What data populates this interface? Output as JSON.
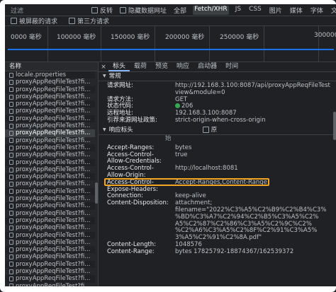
{
  "filter_bar": {
    "filter_label": "过滤",
    "invert_label": "反转",
    "hide_data_urls_label": "隐藏数据网址",
    "types": [
      "全部",
      "Fetch/XHR",
      "JS",
      "CSS",
      "图片",
      "媒体",
      "字体",
      "文档",
      "WS",
      "W"
    ]
  },
  "blocked_bar": {
    "blocked_requests_label": "被屏蔽的请求",
    "third_party_label": "第三方请求"
  },
  "timeline": {
    "ticks": [
      "0000 毫秒",
      "100000 毫秒",
      "150000 毫秒",
      "200000 毫秒",
      "250000 毫秒",
      "300000"
    ]
  },
  "requests": {
    "header": "名称",
    "items": [
      "locale.properties",
      "proxyAppReqFileTest?fi...",
      "proxyAppReqFileTest?fi...",
      "proxyAppReqFileTest?fi...",
      "proxyAppReqFileTest?fi...",
      "proxyAppReqFileTest?fi...",
      "proxyAppReqFileTest?fi...",
      "proxyAppReqFileTest?fi...",
      "proxyAppReqFileTest?fi...",
      "proxyAppReqFileTest?fi...",
      "proxyAppReqFileTest?fi...",
      "proxyAppReqFileTest?fi...",
      "proxyAppReqFileTest?fi...",
      "proxyAppReqFileTest?fi...",
      "proxyAppReqFileTest?fi...",
      "proxyAppReqFileTest?fi...",
      "proxyAppReqFileTest?fi...",
      "proxyAppReqFileTest?fi...",
      "proxyAppReqFileTest?fi...",
      "proxyAppReqFileTest?fi...",
      "proxyAppReqFileTest?fi...",
      "proxyAppReqFileTest?fi...",
      "proxyAppReqFileTest?fi...",
      "proxyAppReqFileTest?fi...",
      "proxyAppReqFileTest?fi...",
      "proxyAppReqFileTest?fi...",
      "proxyAppReqFileTest?fi...",
      "proxyAppReqFileTest?fi...",
      "proxyAppReqFileTest?fi...",
      "proxyAppReqFileTest?fi..."
    ]
  },
  "detail_tabs": {
    "close": "×",
    "items": [
      "标头",
      "载荷",
      "预览",
      "响应",
      "启动器",
      "时间"
    ]
  },
  "general": {
    "title": "常规",
    "request_url_label": "请求网址:",
    "request_url_value_1": "http://192.168.3.100:8087/api/proxyAppReqFileTest",
    "request_url_value_2": "view&module=0",
    "method_label": "请求方法:",
    "method_value": "GET",
    "status_label": "状态代码:",
    "status_value": "206",
    "remote_label": "远程地址:",
    "remote_value": "192.168.3.100:8087",
    "referrer_label": "引荐来源网址政策:",
    "referrer_value": "strict-origin-when-cross-origin"
  },
  "response_headers": {
    "title": "响应标头",
    "raw_label": "原",
    "sub_hint": "始",
    "h1_k": "Accept-Ranges:",
    "h1_v": "bytes",
    "h2_k1": "Access-Control-",
    "h2_k2": "Allow-Credentials:",
    "h2_v": "true",
    "h3_k1": "Access-Control-",
    "h3_k2": "Allow-Origin:",
    "h3_v": "http://localhost:8081",
    "h4_k1": "Access-Control-",
    "h4_k2": "Expose-Headers:",
    "h4_v": "Accept-Ranges,Content-Range",
    "h5_k": "Connection:",
    "h5_v": "keep-alive",
    "h6_k": "Content-Disposition:",
    "h6_v1": "attachment;",
    "h6_v2": "filename=\"2022%C3%A5%C2%B9%C2%B4%C3%",
    "h6_v3": "%BD%C3%A7%C2%94%C2%B5%C3%A5%C2%",
    "h6_v4": "A5%C2%87%C2%86%C3%A5%C2%9C%C2%",
    "h6_v5": "%C2%A6%C3%A5%C2%8F%C2%91%C3%A5%",
    "h6_v6": "3%A5%C2%91%C2%8A.pdf\"",
    "h7_k": "Content-Length:",
    "h7_v": "1048576",
    "h8_k": "Content-Range:",
    "h8_v": "bytes 17825792-18874367/162539372"
  }
}
